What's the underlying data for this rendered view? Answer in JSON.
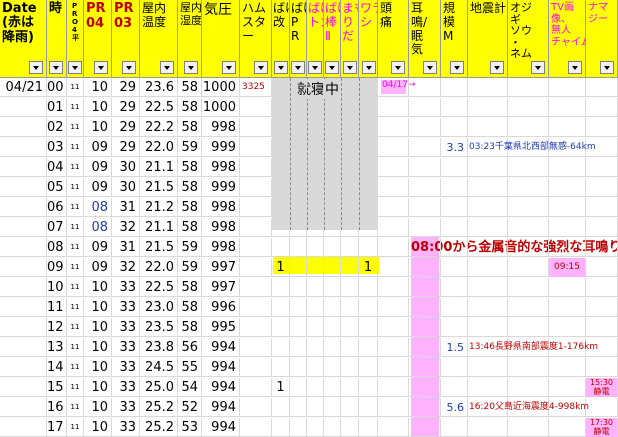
{
  "headers": {
    "date": "Date\n(赤は\n降雨)",
    "hour": "時",
    "pro4": "P\nR\nO\n4\n平",
    "pr04": "PR\n04",
    "pr03": "PR\n03",
    "indoor_temp": "屋内\n温度",
    "indoor_humidity": "屋内\n湿度",
    "pressure": "気圧",
    "hamster": "ハム\nスタ\nー",
    "bake_kai": "ばけ\n改",
    "bake_pr": "ばけ\nP\nR",
    "bake_tka": "ばけ\nトカ",
    "bake_hata": "ばけ\n棒\nⅡ",
    "mamori": "まも\nり\nだ",
    "warashi": "ワラ\nシ",
    "headache": "頭\n痛",
    "tinnitus": "耳\n鳴/\n眠\n気",
    "magnitude": "規\n模\nM",
    "quake": "地震計",
    "ojigi": "オジ\nギ\nソウ\n・\nネム",
    "tv": "TV画\n像、\n無人\nチャイム",
    "namazu": "ナマ\nジー"
  },
  "rows": [
    {
      "date": "04/21",
      "hour": "00",
      "p": "11",
      "pr04": "10",
      "pr03": "29",
      "temp": "23.6",
      "hum": "58",
      "pres": "1000",
      "ham": "3325"
    },
    {
      "date": "",
      "hour": "01",
      "p": "11",
      "pr04": "10",
      "pr03": "29",
      "temp": "22.5",
      "hum": "58",
      "pres": "1000",
      "ham": ""
    },
    {
      "date": "",
      "hour": "02",
      "p": "11",
      "pr04": "10",
      "pr03": "29",
      "temp": "22.2",
      "hum": "58",
      "pres": "998",
      "ham": ""
    },
    {
      "date": "",
      "hour": "03",
      "p": "11",
      "pr04": "09",
      "pr03": "29",
      "temp": "22.0",
      "hum": "59",
      "pres": "999",
      "ham": "",
      "mag": "3.3",
      "quake": "03:23千葉県北西部無感-64km"
    },
    {
      "date": "",
      "hour": "04",
      "p": "11",
      "pr04": "09",
      "pr03": "30",
      "temp": "21.1",
      "hum": "58",
      "pres": "998",
      "ham": ""
    },
    {
      "date": "",
      "hour": "05",
      "p": "11",
      "pr04": "09",
      "pr03": "30",
      "temp": "21.5",
      "hum": "58",
      "pres": "999",
      "ham": ""
    },
    {
      "date": "",
      "hour": "06",
      "p": "11",
      "pr04": "08",
      "pr03": "31",
      "temp": "21.2",
      "hum": "58",
      "pres": "998",
      "ham": "",
      "blue": true
    },
    {
      "date": "",
      "hour": "07",
      "p": "11",
      "pr04": "08",
      "pr03": "32",
      "temp": "21.1",
      "hum": "58",
      "pres": "998",
      "ham": "",
      "blue": true
    },
    {
      "date": "",
      "hour": "08",
      "p": "11",
      "pr04": "09",
      "pr03": "31",
      "temp": "21.5",
      "hum": "59",
      "pres": "998",
      "ham": ""
    },
    {
      "date": "",
      "hour": "09",
      "p": "11",
      "pr04": "09",
      "pr03": "32",
      "temp": "22.0",
      "hum": "59",
      "pres": "997",
      "ham": "",
      "bake_kai": "1",
      "warashi": "1",
      "tv": "09:15"
    },
    {
      "date": "",
      "hour": "10",
      "p": "11",
      "pr04": "10",
      "pr03": "33",
      "temp": "22.5",
      "hum": "58",
      "pres": "997",
      "ham": ""
    },
    {
      "date": "",
      "hour": "11",
      "p": "11",
      "pr04": "10",
      "pr03": "33",
      "temp": "23.0",
      "hum": "58",
      "pres": "996",
      "ham": ""
    },
    {
      "date": "",
      "hour": "12",
      "p": "11",
      "pr04": "10",
      "pr03": "33",
      "temp": "23.5",
      "hum": "58",
      "pres": "995",
      "ham": ""
    },
    {
      "date": "",
      "hour": "13",
      "p": "11",
      "pr04": "10",
      "pr03": "33",
      "temp": "23.8",
      "hum": "56",
      "pres": "994",
      "ham": "",
      "mag": "1.5",
      "quake": "13:46長野県南部震度1-176km"
    },
    {
      "date": "",
      "hour": "14",
      "p": "11",
      "pr04": "10",
      "pr03": "33",
      "temp": "24.5",
      "hum": "55",
      "pres": "994",
      "ham": ""
    },
    {
      "date": "",
      "hour": "15",
      "p": "11",
      "pr04": "10",
      "pr03": "33",
      "temp": "25.0",
      "hum": "54",
      "pres": "994",
      "ham": "",
      "bake_kai": "1",
      "namazu": "15:30\n静電"
    },
    {
      "date": "",
      "hour": "16",
      "p": "11",
      "pr04": "10",
      "pr03": "33",
      "temp": "25.2",
      "hum": "52",
      "pres": "994",
      "ham": "",
      "mag": "5.6",
      "quake": "16:20父島近海震度4-998km"
    },
    {
      "date": "",
      "hour": "17",
      "p": "11",
      "pr04": "10",
      "pr03": "33",
      "temp": "25.2",
      "hum": "53",
      "pres": "994",
      "ham": "",
      "namazu": "17:30\n静電"
    }
  ],
  "annotations": {
    "sleeping": "就寝中",
    "headache_range": "04/17→",
    "tinnitus_event": "08:00から金属音的な強烈な耳鳴り"
  },
  "colors": {
    "header_bg": "#ffff00",
    "sleep_gray": "#d9d9d9",
    "pink": "#ffb3ff",
    "yellow": "#ffff00",
    "red_text": "#c00000",
    "blue_text": "#1f3cb5",
    "magenta_text": "#ff00ff"
  }
}
